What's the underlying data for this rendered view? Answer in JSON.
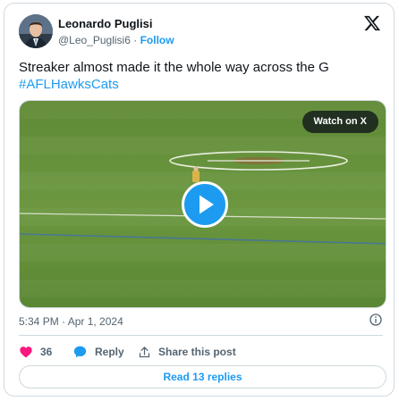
{
  "author": {
    "name": "Leonardo Puglisi",
    "handle": "@Leo_Puglisi6",
    "separator": "·",
    "follow_label": "Follow"
  },
  "icons": {
    "brand": "x-logo-icon",
    "info": "info-icon",
    "like": "heart-icon",
    "reply": "reply-bubble-icon",
    "share": "share-upload-icon",
    "play": "play-icon"
  },
  "tweet": {
    "text": "Streaker almost made it the whole way across the G",
    "hashtag": "#AFLHawksCats"
  },
  "media": {
    "watch_label": "Watch on X"
  },
  "timestamp": "5:34 PM · Apr 1, 2024",
  "actions": {
    "like_count": "36",
    "reply_label": "Reply",
    "share_label": "Share this post"
  },
  "read_replies_label": "Read 13 replies",
  "colors": {
    "accent": "#1d9bf0",
    "like": "#f91880",
    "text": "#0f1419",
    "muted": "#536471",
    "border": "#cfd9de"
  }
}
